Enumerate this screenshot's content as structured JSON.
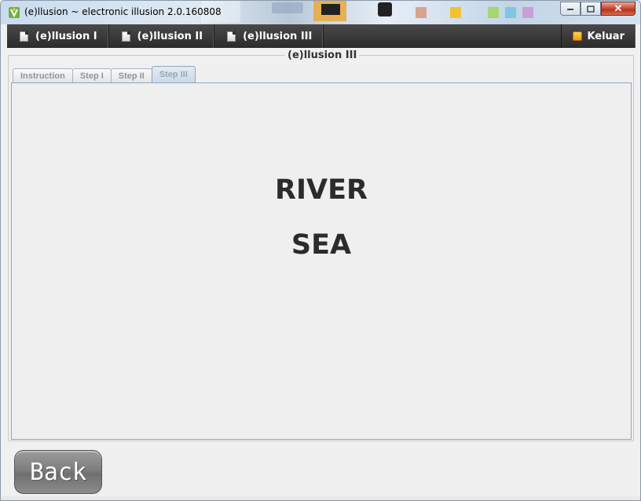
{
  "window": {
    "title": "(e)llusion ~ electronic illusion 2.0.160808",
    "app_icon": "illusion-app-icon",
    "controls": {
      "minimize_icon": "minimize-icon",
      "maximize_icon": "maximize-icon",
      "close_icon": "close-icon",
      "close_glyph": "✕"
    }
  },
  "menubar": {
    "items": [
      {
        "label": "(e)llusion I",
        "icon": "document-icon"
      },
      {
        "label": "(e)llusion II",
        "icon": "document-icon"
      },
      {
        "label": "(e)llusion III",
        "icon": "document-icon"
      }
    ],
    "exit": {
      "label": "Keluar",
      "icon": "exit-icon"
    }
  },
  "group": {
    "title": "(e)llusion III"
  },
  "tabs": [
    {
      "label": "Instruction",
      "active": false
    },
    {
      "label": "Step I",
      "active": false
    },
    {
      "label": "Step II",
      "active": false
    },
    {
      "label": "Step III",
      "active": true
    }
  ],
  "content": {
    "word_1": "RIVER",
    "word_2": "SEA"
  },
  "back_button": {
    "label": "Back"
  },
  "colors": {
    "menubar": "#2b2b2b",
    "active_tab": "#cbd9e8",
    "panel_border": "#8fa7c0",
    "text": "#2b2b2b",
    "close_button": "#c8462c"
  }
}
